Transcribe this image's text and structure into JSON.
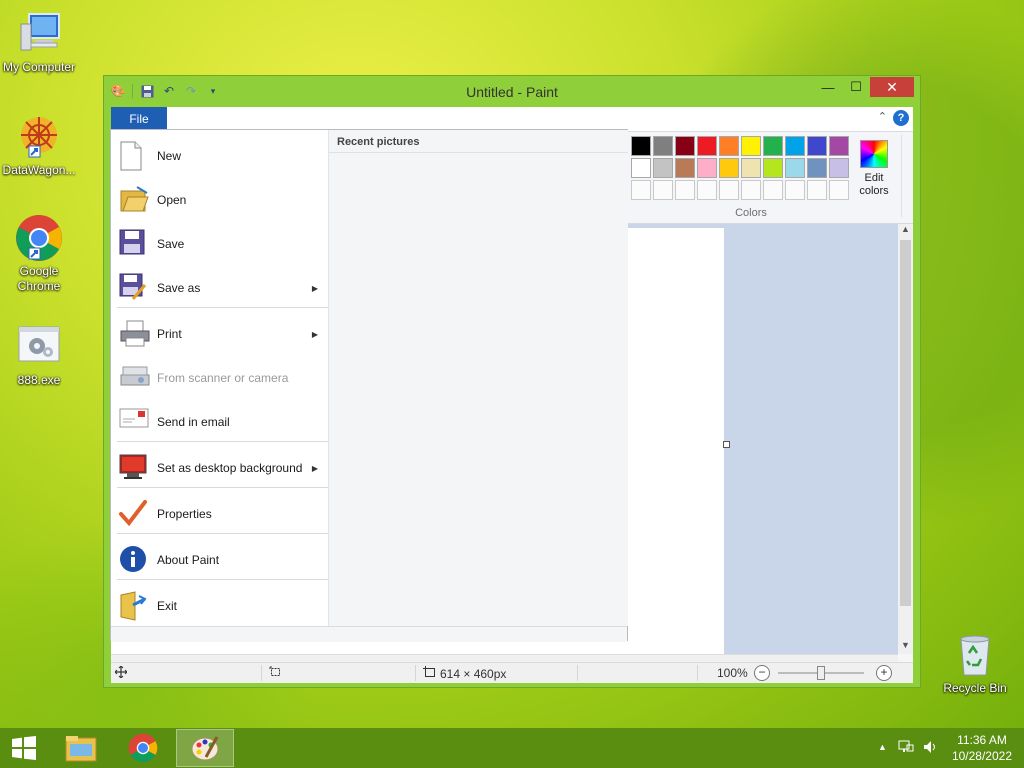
{
  "desktop": {
    "icons": [
      {
        "label": "My Computer"
      },
      {
        "label": "DataWagon..."
      },
      {
        "label": "Google Chrome"
      },
      {
        "label": "888.exe"
      },
      {
        "label": "Recycle Bin"
      }
    ]
  },
  "window": {
    "title": "Untitled - Paint",
    "buttons": {
      "minimize": "—",
      "maximize": "☐",
      "close": "✕"
    }
  },
  "ribbon": {
    "file_tab": "File",
    "colors_label": "Colors",
    "edit_colors_line1": "Edit",
    "edit_colors_line2": "colors",
    "help": "?",
    "palette_row1": [
      "#000000",
      "#7f7f7f",
      "#880015",
      "#ed1c24",
      "#ff7f27",
      "#fff200",
      "#22b14c",
      "#00a2e8",
      "#3f48cc",
      "#a349a4"
    ],
    "palette_row2": [
      "#ffffff",
      "#c3c3c3",
      "#b97a57",
      "#ffaec9",
      "#ffc90e",
      "#efe4b0",
      "#b5e61d",
      "#99d9ea",
      "#7092be",
      "#c8bfe7"
    ]
  },
  "file_menu": {
    "items": [
      {
        "label": "New",
        "icon": "new-file-icon"
      },
      {
        "label": "Open",
        "icon": "open-folder-icon"
      },
      {
        "label": "Save",
        "icon": "save-disk-icon"
      },
      {
        "label": "Save as",
        "icon": "save-as-icon"
      },
      {
        "label": "Print",
        "icon": "printer-icon"
      },
      {
        "label": "From scanner or camera",
        "icon": "scanner-icon"
      },
      {
        "label": "Send in email",
        "icon": "email-icon"
      },
      {
        "label": "Set as desktop background",
        "icon": "desktop-background-icon"
      },
      {
        "label": "Properties",
        "icon": "checkmark-icon"
      },
      {
        "label": "About Paint",
        "icon": "info-icon"
      },
      {
        "label": "Exit",
        "icon": "exit-icon"
      }
    ],
    "recent_title": "Recent pictures"
  },
  "statusbar": {
    "image_size": "614 × 460px",
    "zoom": "100%",
    "zoom_level": 0.5
  },
  "taskbar": {
    "time": "11:36 AM",
    "date": "10/28/2022"
  }
}
